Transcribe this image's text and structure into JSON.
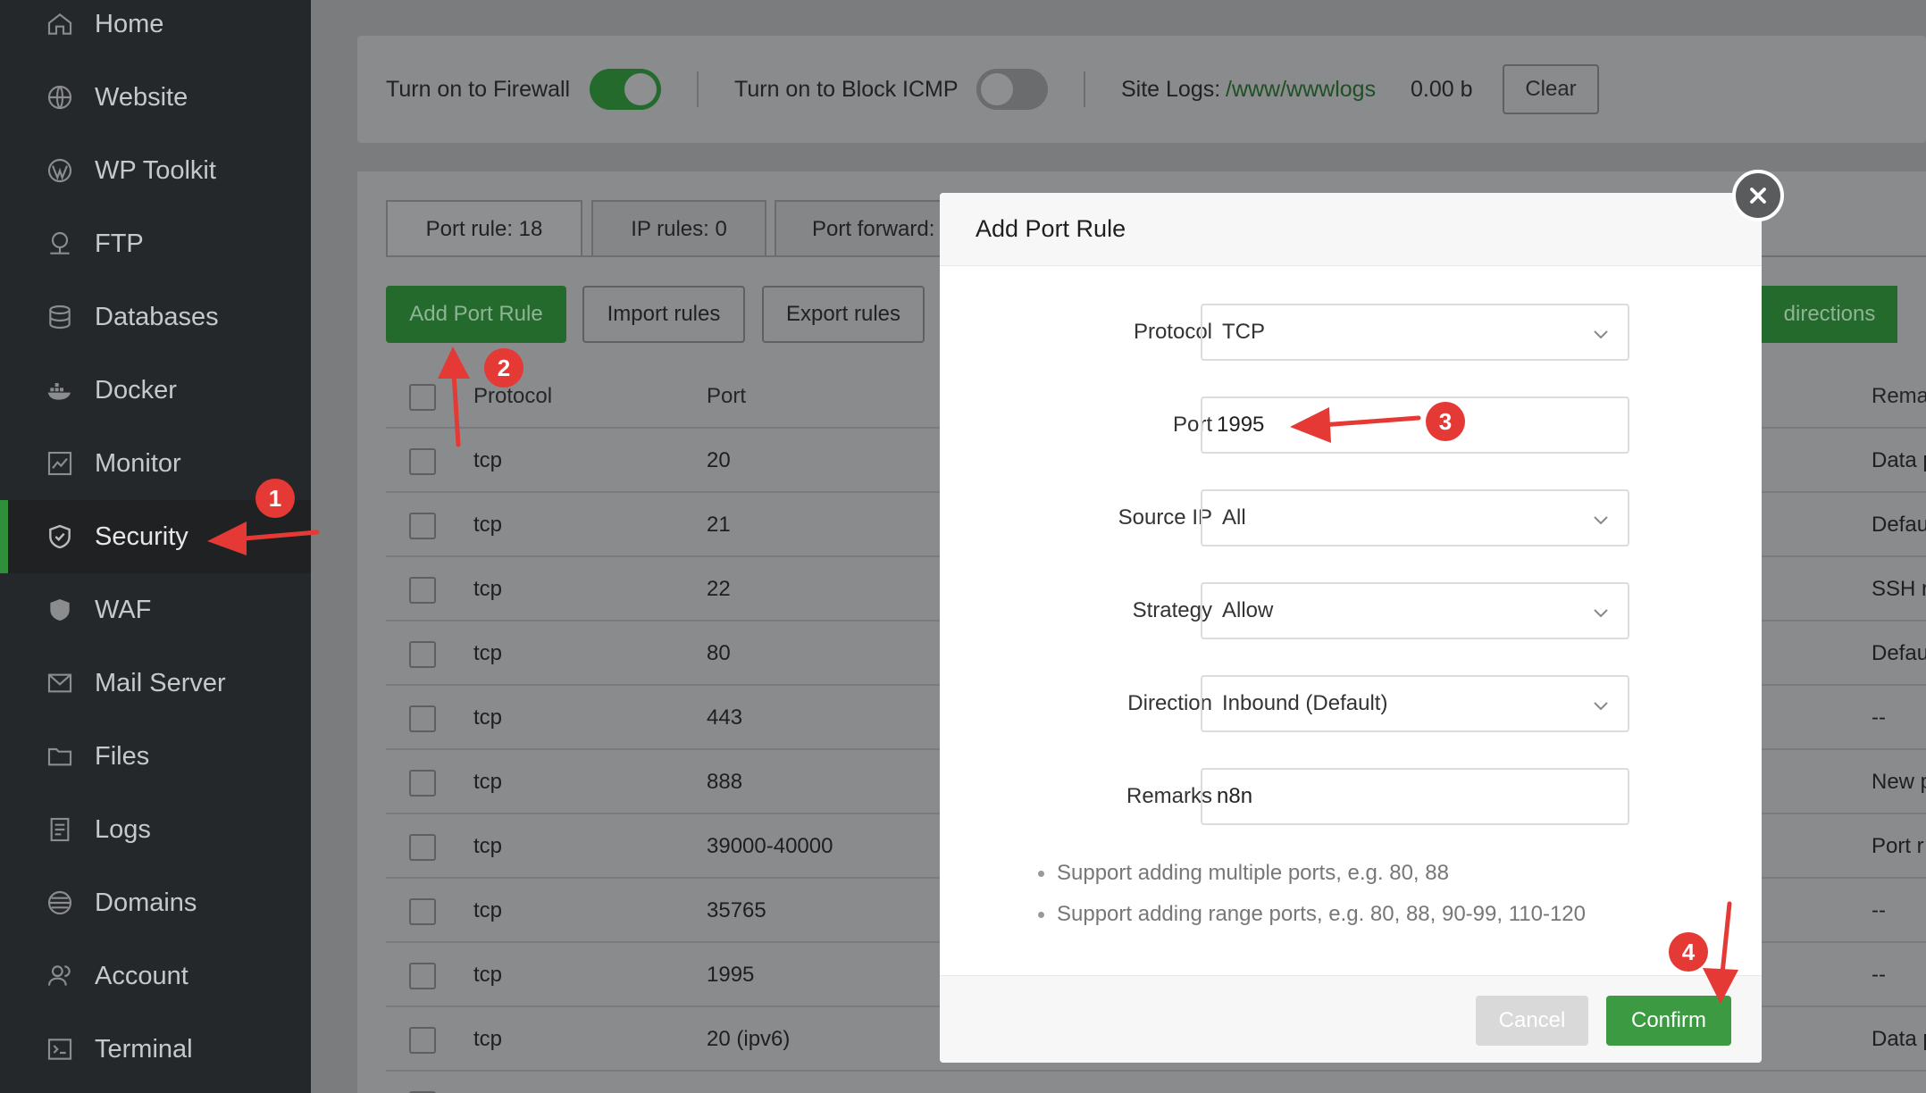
{
  "sidebar": {
    "items": [
      {
        "label": "Home",
        "icon": "home-icon"
      },
      {
        "label": "Website",
        "icon": "globe-icon"
      },
      {
        "label": "WP Toolkit",
        "icon": "wordpress-icon"
      },
      {
        "label": "FTP",
        "icon": "ftp-icon"
      },
      {
        "label": "Databases",
        "icon": "database-icon"
      },
      {
        "label": "Docker",
        "icon": "docker-icon"
      },
      {
        "label": "Monitor",
        "icon": "monitor-icon"
      },
      {
        "label": "Security",
        "icon": "shield-icon",
        "active": true
      },
      {
        "label": "WAF",
        "icon": "waf-icon"
      },
      {
        "label": "Mail Server",
        "icon": "mail-icon"
      },
      {
        "label": "Files",
        "icon": "folder-icon"
      },
      {
        "label": "Logs",
        "icon": "logs-icon"
      },
      {
        "label": "Domains",
        "icon": "domains-icon"
      },
      {
        "label": "Account",
        "icon": "account-icon"
      },
      {
        "label": "Terminal",
        "icon": "terminal-icon"
      }
    ]
  },
  "topbar": {
    "firewall_label": "Turn on to Firewall",
    "firewall_on": true,
    "icmp_label": "Turn on to Block ICMP",
    "icmp_on": false,
    "site_logs_label": "Site Logs:",
    "site_logs_path": "/www/wwwlogs",
    "site_logs_size": "0.00 b",
    "clear_label": "Clear"
  },
  "tabs": [
    {
      "label": "Port rule: 18",
      "active": true
    },
    {
      "label": "IP rules: 0",
      "active": false
    },
    {
      "label": "Port forward:",
      "active": false
    }
  ],
  "toolbar": {
    "add_label": "Add Port Rule",
    "import_label": "Import rules",
    "export_label": "Export rules",
    "directions_label": "directions"
  },
  "table": {
    "headers": {
      "protocol": "Protocol",
      "port": "Port",
      "remarks": "Rema"
    },
    "rows": [
      {
        "protocol": "tcp",
        "port": "20",
        "remarks": "Data p"
      },
      {
        "protocol": "tcp",
        "port": "21",
        "remarks": "Defau"
      },
      {
        "protocol": "tcp",
        "port": "22",
        "remarks": "SSH r"
      },
      {
        "protocol": "tcp",
        "port": "80",
        "remarks": "Defau"
      },
      {
        "protocol": "tcp",
        "port": "443",
        "remarks": "--"
      },
      {
        "protocol": "tcp",
        "port": "888",
        "remarks": "New p"
      },
      {
        "protocol": "tcp",
        "port": "39000-40000",
        "remarks": "Port r"
      },
      {
        "protocol": "tcp",
        "port": "35765",
        "remarks": "--"
      },
      {
        "protocol": "tcp",
        "port": "1995",
        "remarks": "--"
      },
      {
        "protocol": "tcp",
        "port": "20 (ipv6)",
        "remarks": "Data p"
      }
    ]
  },
  "modal": {
    "title": "Add Port Rule",
    "fields": {
      "protocol": {
        "label": "Protocol",
        "value": "TCP"
      },
      "port": {
        "label": "Port",
        "value": "1995"
      },
      "source_ip": {
        "label": "Source IP",
        "value": "All"
      },
      "strategy": {
        "label": "Strategy",
        "value": "Allow"
      },
      "direction": {
        "label": "Direction",
        "value": "Inbound (Default)"
      },
      "remarks": {
        "label": "Remarks",
        "value": "n8n"
      }
    },
    "notes": [
      "Support adding multiple ports, e.g. 80, 88",
      "Support adding range ports, e.g. 80, 88, 90-99, 110-120"
    ],
    "cancel_label": "Cancel",
    "confirm_label": "Confirm"
  },
  "annotations": {
    "badges": [
      "1",
      "2",
      "3",
      "4"
    ],
    "color": "#e53935"
  },
  "colors": {
    "accent_green": "#3b9a42",
    "sidebar_bg": "#25282b"
  }
}
